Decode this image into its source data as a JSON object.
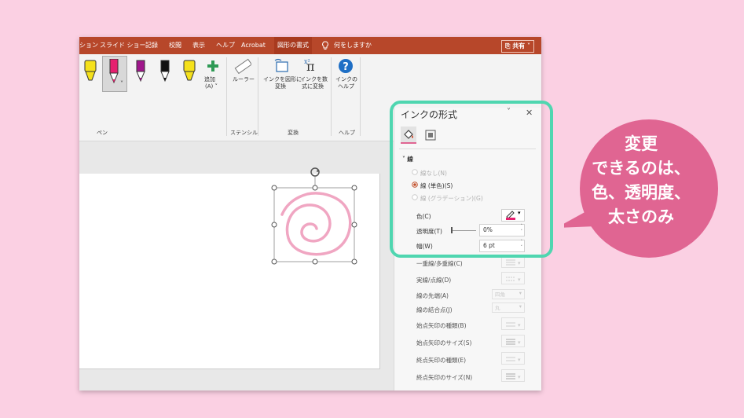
{
  "tabs": [
    "ション",
    "スライド ショー",
    "記録",
    "校閲",
    "表示",
    "ヘルプ",
    "Acrobat",
    "図形の書式"
  ],
  "tell_me": "何をしますか",
  "share_label": "共有",
  "ribbon": {
    "add_label": "追加",
    "add_sub": "(A) ˅",
    "ruler_label": "ルーラー",
    "ink_to_shape_l1": "インクを図形に",
    "ink_to_shape_l2": "変換",
    "ink_to_math_l1": "インクを数",
    "ink_to_math_l2": "式に変換",
    "ink_help_l1": "インクの",
    "ink_help_l2": "ヘルプ",
    "groups": {
      "pen": "ペン",
      "stencil": "ステンシル",
      "convert": "変換",
      "help": "ヘルプ"
    }
  },
  "pen_colors": [
    "#f5e11b",
    "#e6206f",
    "#a0168c",
    "#111111",
    "#f5e11b"
  ],
  "pane": {
    "title": "インクの形式",
    "section": "線",
    "opt_none": "線なし(N)",
    "opt_solid": "線 (単色)(S)",
    "opt_gradient": "線 (グラデーション)(G)",
    "color_label": "色(C)",
    "transparency_label": "透明度(T)",
    "transparency_value": "0%",
    "width_label": "幅(W)",
    "width_value": "6 pt",
    "compound_label": "一重線/多重線(C)",
    "dash_label": "実線/点線(D)",
    "cap_label": "線の先端(A)",
    "cap_value": "四角",
    "join_label": "線の結合点(J)",
    "join_value": "丸",
    "begin_arrow_type": "始点矢印の種類(B)",
    "begin_arrow_size": "始点矢印のサイズ(S)",
    "end_arrow_type": "終点矢印の種類(E)",
    "end_arrow_size": "終点矢印のサイズ(N)"
  },
  "callout": {
    "line1": "変更",
    "line2": "できるのは、",
    "line3": "色、透明度、",
    "line4": "太さのみ"
  },
  "colors": {
    "accent": "#b7472a",
    "highlight": "#4fd6b0",
    "callout": "#e06592",
    "background": "#fbd0e3",
    "ink": "#e6206f"
  }
}
